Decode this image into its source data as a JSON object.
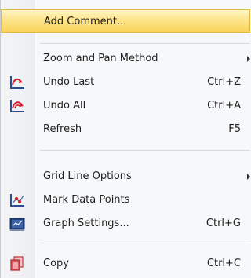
{
  "menu": {
    "items": [
      {
        "label": "Add Comment...",
        "shortcut": "",
        "icon": "",
        "submenu": false,
        "highlighted": true
      },
      {
        "label": "Zoom and Pan Method",
        "shortcut": "",
        "icon": "",
        "submenu": true
      },
      {
        "label": "Undo Last",
        "shortcut": "Ctrl+Z",
        "icon": "undo-last-icon",
        "submenu": false
      },
      {
        "label": "Undo All",
        "shortcut": "Ctrl+A",
        "icon": "undo-all-icon",
        "submenu": false
      },
      {
        "label": "Refresh",
        "shortcut": "F5",
        "icon": "",
        "submenu": false
      },
      {
        "label": "Grid Line Options",
        "shortcut": "",
        "icon": "",
        "submenu": true
      },
      {
        "label": "Mark Data Points",
        "shortcut": "",
        "icon": "mark-data-points-icon",
        "submenu": false
      },
      {
        "label": "Graph Settings...",
        "shortcut": "Ctrl+G",
        "icon": "graph-settings-icon",
        "submenu": false
      },
      {
        "label": "Copy",
        "shortcut": "Ctrl+C",
        "icon": "copy-icon",
        "submenu": false
      }
    ]
  },
  "colors": {
    "highlight": "#f8d35a",
    "accent_red": "#d0202a",
    "accent_blue": "#2a4f8f"
  }
}
